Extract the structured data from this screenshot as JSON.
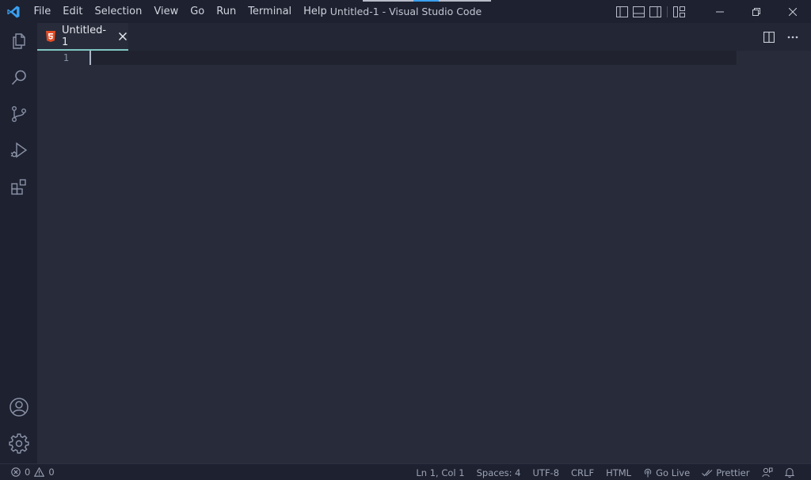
{
  "window": {
    "title": "Untitled-1 - Visual Studio Code"
  },
  "menu": [
    "File",
    "Edit",
    "Selection",
    "View",
    "Go",
    "Run",
    "Terminal",
    "Help"
  ],
  "tabs": [
    {
      "label": "Untitled-1",
      "icon": "html5-icon",
      "active": true
    }
  ],
  "editor": {
    "line_numbers": [
      "1"
    ],
    "content": ""
  },
  "status": {
    "errors": "0",
    "warnings": "0",
    "position": "Ln 1, Col 1",
    "indentation": "Spaces: 4",
    "encoding": "UTF-8",
    "eol": "CRLF",
    "language": "HTML",
    "go_live": "Go Live",
    "prettier": "Prettier"
  },
  "colors": {
    "titlebar_bg": "#1d2130",
    "editor_bg": "#282c3a",
    "active_tab_border": "#7fc6c2",
    "vscode_blue": "#3aa0f0",
    "html5_orange": "#e44d26"
  }
}
